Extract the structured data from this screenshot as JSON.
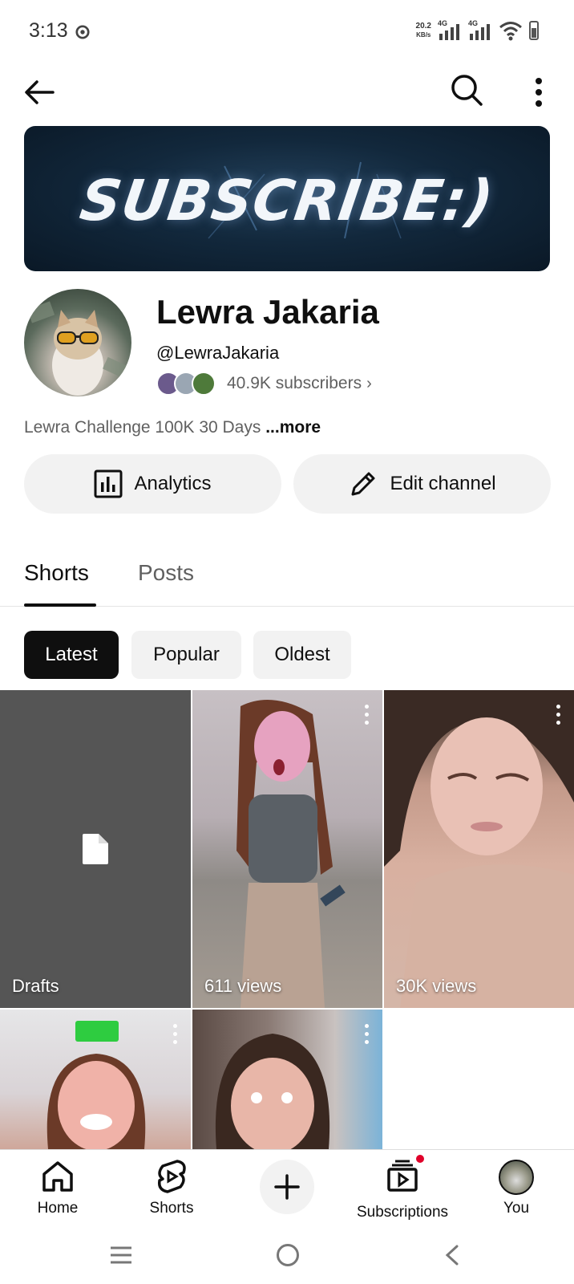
{
  "status_bar": {
    "time": "3:13",
    "net_speed_value": "20.2",
    "net_speed_unit": "KB/s",
    "signal1": "4G",
    "signal2": "4G"
  },
  "channel": {
    "banner_text": "SUBSCRIBE:)",
    "name": "Lewra Jakaria",
    "handle": "@LewraJakaria",
    "subscribers": "40.9K subscribers",
    "description": "Lewra Challenge 100K 30 Days",
    "more_label": "...more"
  },
  "actions": {
    "analytics_label": "Analytics",
    "edit_label": "Edit channel"
  },
  "tabs": [
    {
      "label": "Shorts",
      "selected": true
    },
    {
      "label": "Posts",
      "selected": false
    }
  ],
  "chips": [
    {
      "label": "Latest",
      "selected": true
    },
    {
      "label": "Popular",
      "selected": false
    },
    {
      "label": "Oldest",
      "selected": false
    }
  ],
  "grid": [
    {
      "label": "Drafts"
    },
    {
      "label": "611 views"
    },
    {
      "label": "30K views"
    },
    {
      "label": ""
    },
    {
      "label": ""
    }
  ],
  "bottom_nav": [
    {
      "label": "Home",
      "icon": "home-icon"
    },
    {
      "label": "Shorts",
      "icon": "shorts-icon"
    },
    {
      "label": "",
      "icon": "plus-icon"
    },
    {
      "label": "Subscriptions",
      "icon": "subscriptions-icon"
    },
    {
      "label": "You",
      "icon": "avatar"
    }
  ],
  "colors": {
    "text": "#0f0f0f",
    "secondary_text": "#606060",
    "chip_bg": "#f2f2f2",
    "notification": "#e0002a"
  }
}
